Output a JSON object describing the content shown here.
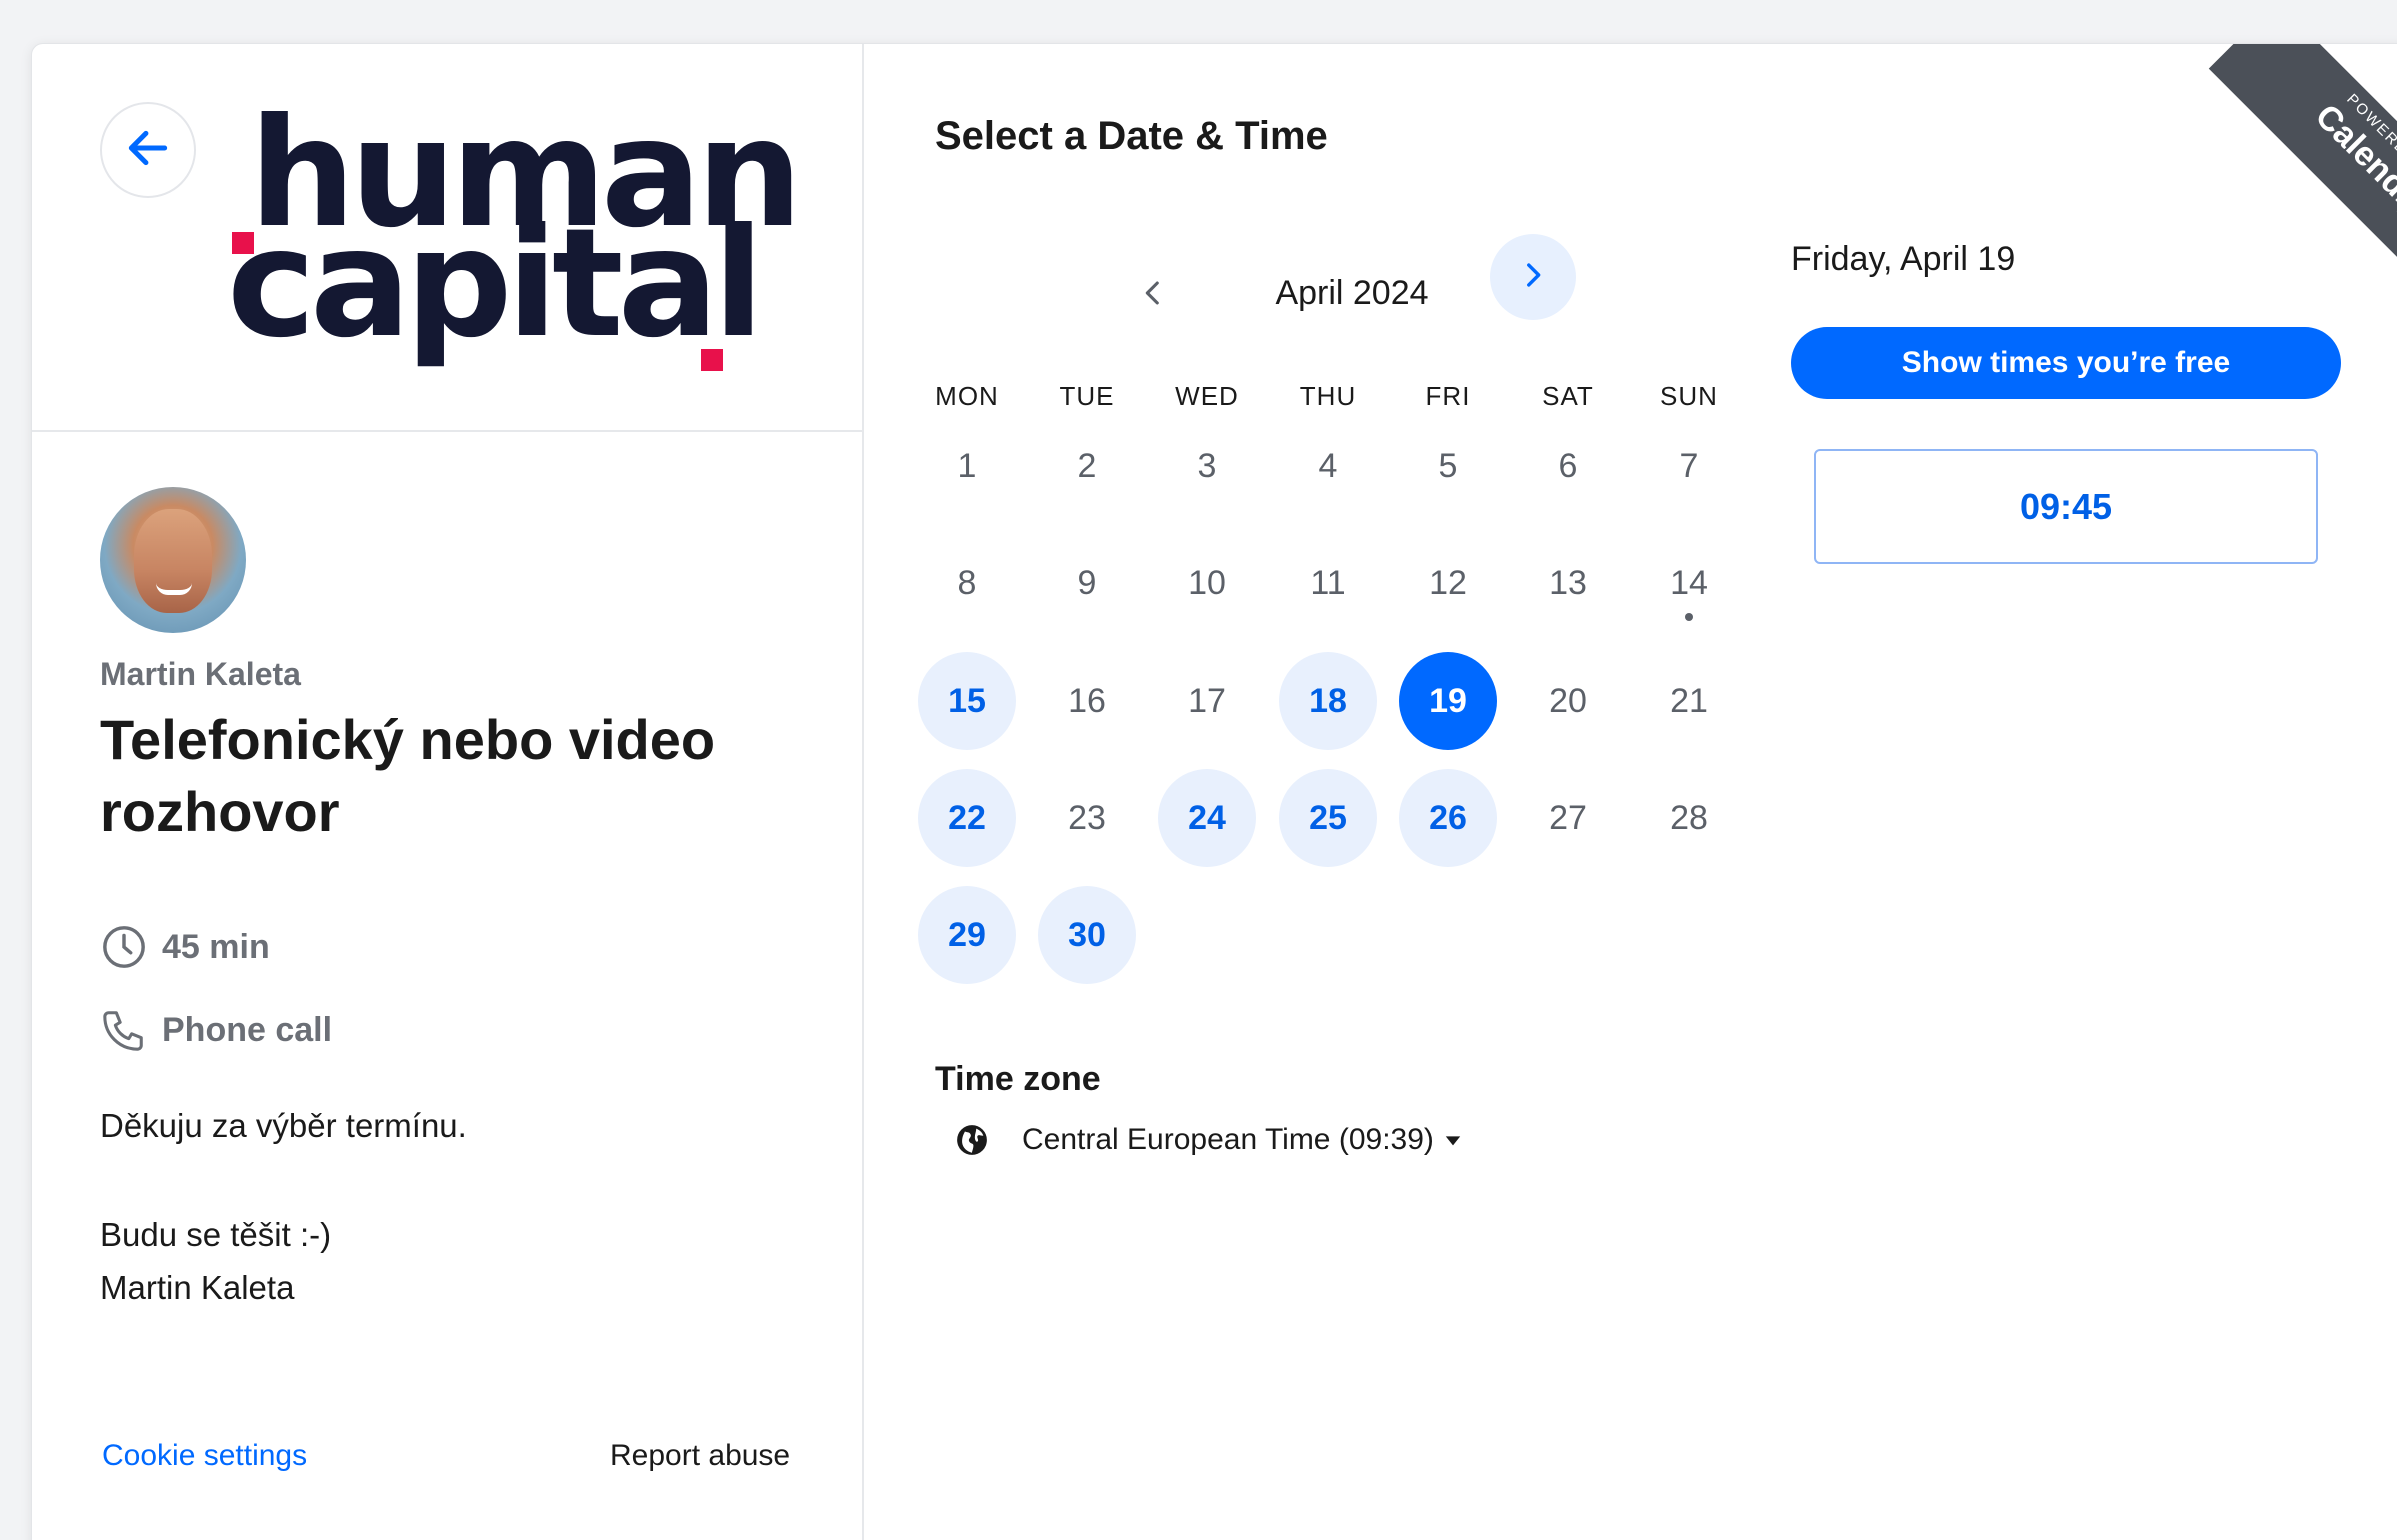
{
  "left": {
    "logo": {
      "line1": "human",
      "line2": "capital"
    },
    "organizer": "Martin Kaleta",
    "event_title": "Telefonický nebo video rozhovor",
    "duration": "45 min",
    "location": "Phone call",
    "description": [
      "Děkuju za výběr termínu.",
      "Budu se těšit :-)",
      "Martin Kaleta"
    ],
    "cookie_settings": "Cookie settings",
    "report_abuse": "Report abuse"
  },
  "calendar": {
    "heading": "Select a Date & Time",
    "month": "April 2024",
    "weekdays": [
      "MON",
      "TUE",
      "WED",
      "THU",
      "FRI",
      "SAT",
      "SUN"
    ],
    "days": [
      {
        "d": "1",
        "state": "none"
      },
      {
        "d": "2",
        "state": "none"
      },
      {
        "d": "3",
        "state": "none"
      },
      {
        "d": "4",
        "state": "none"
      },
      {
        "d": "5",
        "state": "none"
      },
      {
        "d": "6",
        "state": "none"
      },
      {
        "d": "7",
        "state": "none"
      },
      {
        "d": "8",
        "state": "none"
      },
      {
        "d": "9",
        "state": "none"
      },
      {
        "d": "10",
        "state": "none"
      },
      {
        "d": "11",
        "state": "none"
      },
      {
        "d": "12",
        "state": "none"
      },
      {
        "d": "13",
        "state": "none"
      },
      {
        "d": "14",
        "state": "today"
      },
      {
        "d": "15",
        "state": "available"
      },
      {
        "d": "16",
        "state": "none"
      },
      {
        "d": "17",
        "state": "none"
      },
      {
        "d": "18",
        "state": "available"
      },
      {
        "d": "19",
        "state": "selected"
      },
      {
        "d": "20",
        "state": "none"
      },
      {
        "d": "21",
        "state": "none"
      },
      {
        "d": "22",
        "state": "available"
      },
      {
        "d": "23",
        "state": "none"
      },
      {
        "d": "24",
        "state": "available"
      },
      {
        "d": "25",
        "state": "available"
      },
      {
        "d": "26",
        "state": "available"
      },
      {
        "d": "27",
        "state": "none"
      },
      {
        "d": "28",
        "state": "none"
      },
      {
        "d": "29",
        "state": "available"
      },
      {
        "d": "30",
        "state": "available"
      }
    ],
    "timezone_label": "Time zone",
    "timezone_value": "Central European Time (09:39)"
  },
  "slots": {
    "selected_date": "Friday, April 19",
    "show_free_button": "Show times you’re free",
    "times": [
      "09:45"
    ]
  },
  "ribbon": {
    "line1": "POWERED BY",
    "line2": "Calendly"
  },
  "colors": {
    "accent": "#0069ff",
    "available_bg": "#e8f0fd",
    "logo_red": "#e8114b",
    "logo_navy": "#141832"
  }
}
